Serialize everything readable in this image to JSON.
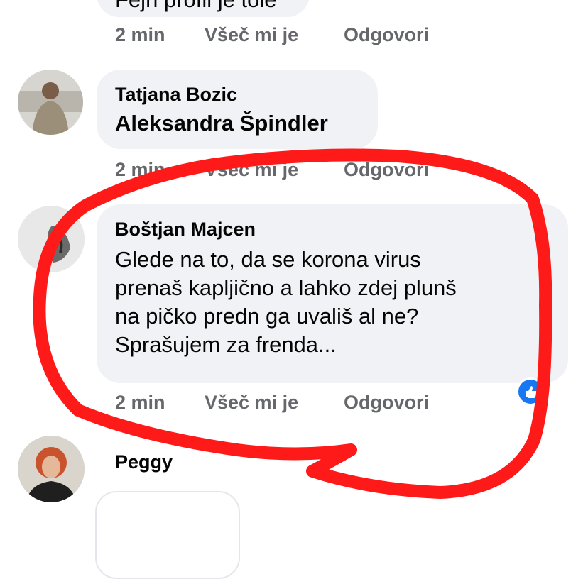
{
  "comments": [
    {
      "author": "",
      "text": "Fejn profil je tole",
      "time": "2 min",
      "like_label": "Všeč mi je",
      "reply_label": "Odgovori"
    },
    {
      "author": "Tatjana Bozic",
      "text": "Aleksandra Špindler",
      "time": "2 min",
      "like_label": "Všeč mi je",
      "reply_label": "Odgovori"
    },
    {
      "author": "Boštjan Majcen",
      "text_lines": [
        "Glede na to, da se korona virus",
        "prenaš kapljično a lahko zdej plunš",
        "na pičko predn ga uvališ al ne?",
        "Sprašujem za frenda..."
      ],
      "time": "2 min",
      "like_label": "Všeč mi je",
      "reply_label": "Odgovori",
      "reaction_icon": "thumbs-up-icon"
    },
    {
      "author": "Peggy"
    }
  ],
  "colors": {
    "bubble": "#f0f2f5",
    "meta_text": "#65676b",
    "reaction": "#1877f2",
    "annotation": "#ff1a1a"
  }
}
